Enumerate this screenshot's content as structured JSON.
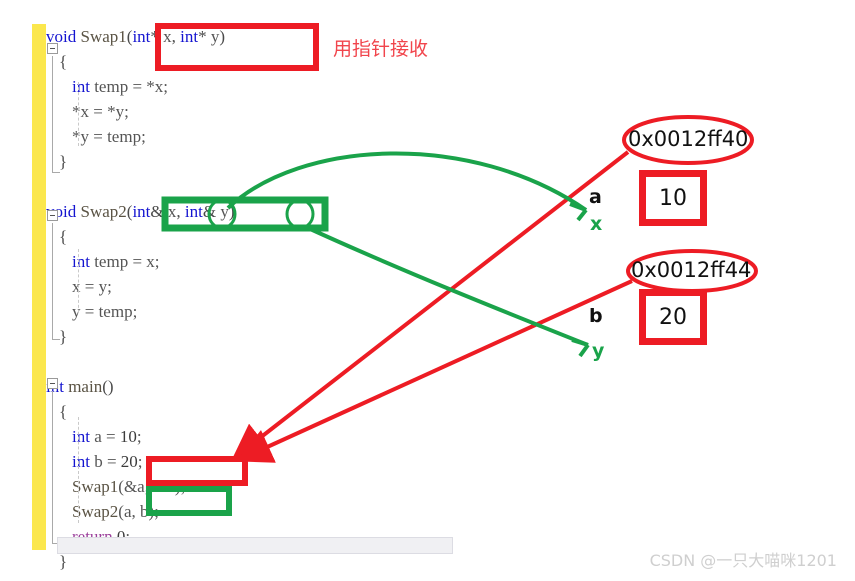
{
  "editor": {
    "code_lines": [
      {
        "indent": 0,
        "tokens": [
          {
            "t": "void ",
            "c": "kw"
          },
          {
            "t": "Swap1",
            "c": "fn"
          },
          {
            "t": "(",
            "c": "pl"
          },
          {
            "t": "int",
            "c": "kw"
          },
          {
            "t": "* ",
            "c": "pl"
          },
          {
            "t": "x",
            "c": "id"
          },
          {
            "t": ", ",
            "c": "pl"
          },
          {
            "t": "int",
            "c": "kw"
          },
          {
            "t": "* ",
            "c": "pl"
          },
          {
            "t": "y",
            "c": "id"
          },
          {
            "t": ")",
            "c": "pl"
          }
        ]
      },
      {
        "indent": 1,
        "tokens": [
          {
            "t": "{",
            "c": "pl"
          }
        ]
      },
      {
        "indent": 2,
        "tokens": [
          {
            "t": "int ",
            "c": "kw"
          },
          {
            "t": "temp = *x;",
            "c": "id"
          }
        ]
      },
      {
        "indent": 2,
        "tokens": [
          {
            "t": "*x = *y;",
            "c": "id"
          }
        ]
      },
      {
        "indent": 2,
        "tokens": [
          {
            "t": "*y = temp;",
            "c": "id"
          }
        ]
      },
      {
        "indent": 1,
        "tokens": [
          {
            "t": "}",
            "c": "pl"
          }
        ]
      },
      {
        "indent": 0,
        "tokens": []
      },
      {
        "indent": 0,
        "tokens": [
          {
            "t": "void ",
            "c": "kw"
          },
          {
            "t": "Swap2",
            "c": "fn"
          },
          {
            "t": "(",
            "c": "pl"
          },
          {
            "t": "int",
            "c": "kw"
          },
          {
            "t": "& ",
            "c": "pl"
          },
          {
            "t": "x",
            "c": "id"
          },
          {
            "t": ", ",
            "c": "pl"
          },
          {
            "t": "int",
            "c": "kw"
          },
          {
            "t": "& ",
            "c": "pl"
          },
          {
            "t": "y",
            "c": "id"
          },
          {
            "t": ")",
            "c": "pl"
          }
        ]
      },
      {
        "indent": 1,
        "tokens": [
          {
            "t": "{",
            "c": "pl"
          }
        ]
      },
      {
        "indent": 2,
        "tokens": [
          {
            "t": "int ",
            "c": "kw"
          },
          {
            "t": "temp = x;",
            "c": "id"
          }
        ]
      },
      {
        "indent": 2,
        "tokens": [
          {
            "t": "x = y;",
            "c": "id"
          }
        ]
      },
      {
        "indent": 2,
        "tokens": [
          {
            "t": "y = temp;",
            "c": "id"
          }
        ]
      },
      {
        "indent": 1,
        "tokens": [
          {
            "t": "}",
            "c": "pl"
          }
        ]
      },
      {
        "indent": 0,
        "tokens": []
      },
      {
        "indent": 0,
        "tokens": [
          {
            "t": "int ",
            "c": "kw"
          },
          {
            "t": "main",
            "c": "fn"
          },
          {
            "t": "()",
            "c": "pl"
          }
        ]
      },
      {
        "indent": 1,
        "tokens": [
          {
            "t": "{",
            "c": "pl"
          }
        ]
      },
      {
        "indent": 2,
        "tokens": [
          {
            "t": "int ",
            "c": "kw"
          },
          {
            "t": "a = ",
            "c": "id"
          },
          {
            "t": "10",
            "c": "num"
          },
          {
            "t": ";",
            "c": "id"
          }
        ]
      },
      {
        "indent": 2,
        "tokens": [
          {
            "t": "int ",
            "c": "kw"
          },
          {
            "t": "b = ",
            "c": "id"
          },
          {
            "t": "20",
            "c": "num"
          },
          {
            "t": ";",
            "c": "id"
          }
        ]
      },
      {
        "indent": 2,
        "tokens": [
          {
            "t": "Swap1",
            "c": "fn"
          },
          {
            "t": "(&a, &b);",
            "c": "id"
          }
        ]
      },
      {
        "indent": 2,
        "tokens": [
          {
            "t": "Swap2",
            "c": "fn"
          },
          {
            "t": "(a, b);",
            "c": "id"
          }
        ]
      },
      {
        "indent": 2,
        "tokens": [
          {
            "t": "return ",
            "c": "ret"
          },
          {
            "t": "0",
            "c": "num"
          },
          {
            "t": ";",
            "c": "id"
          }
        ]
      },
      {
        "indent": 1,
        "tokens": [
          {
            "t": "}",
            "c": "pl"
          }
        ]
      }
    ]
  },
  "annotations": {
    "chinese_note": "用指针接收",
    "memory_cells": [
      {
        "address": "0x0012ff40",
        "var_name": "a",
        "ref_name": "x",
        "value": "10"
      },
      {
        "address": "0x0012ff44",
        "var_name": "b",
        "ref_name": "y",
        "value": "20"
      }
    ],
    "colors": {
      "red": "#ed1c24",
      "green": "#1aa34a",
      "keyword_blue": "#1414d0",
      "return_purple": "#9b3f9b",
      "change_bar_yellow": "#fbe74d"
    }
  },
  "watermark": {
    "text": "CSDN @一只大喵咪1201"
  }
}
